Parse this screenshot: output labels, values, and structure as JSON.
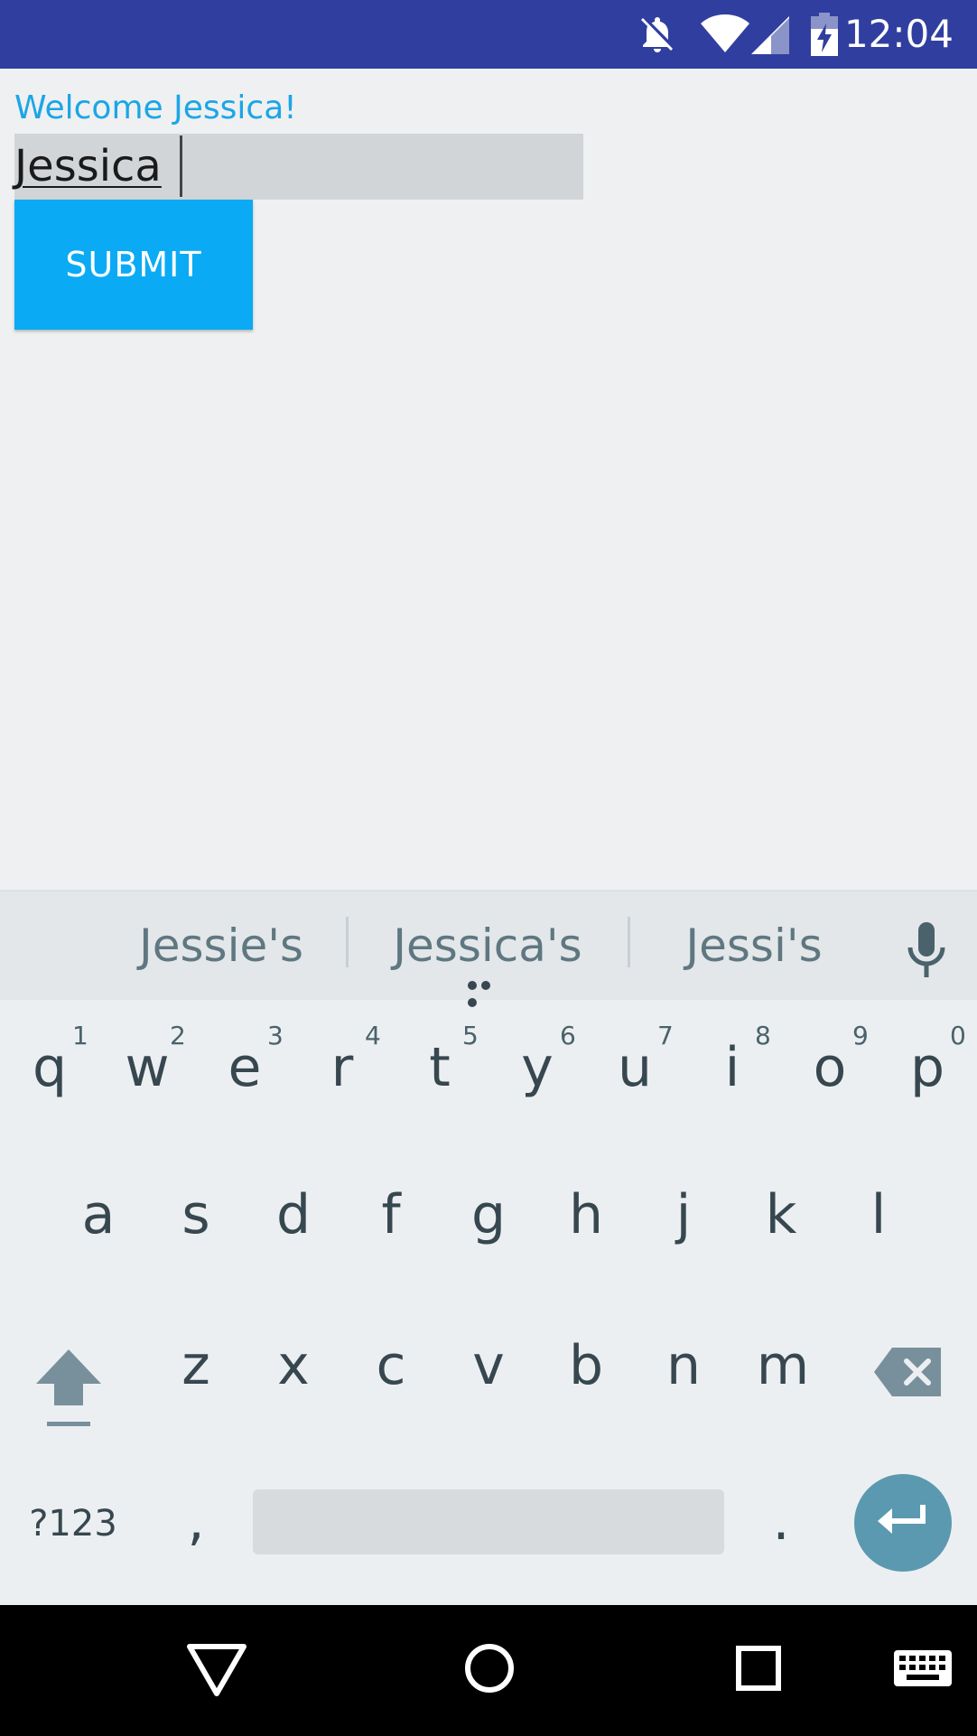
{
  "status_bar": {
    "time": "12:04",
    "icons": [
      "notifications-off-icon",
      "wifi-icon",
      "cell-signal-icon",
      "battery-charging-icon"
    ],
    "background": "#303f9f"
  },
  "app": {
    "welcome_text": "Welcome Jessica!",
    "name_input_value": "Jessica",
    "submit_label": "SUBMIT",
    "accent": "#0aabf4"
  },
  "keyboard": {
    "suggestions": [
      "Jessie's",
      "Jessica's",
      "Jessi's"
    ],
    "row1": [
      {
        "key": "q",
        "hint": "1"
      },
      {
        "key": "w",
        "hint": "2"
      },
      {
        "key": "e",
        "hint": "3"
      },
      {
        "key": "r",
        "hint": "4"
      },
      {
        "key": "t",
        "hint": "5"
      },
      {
        "key": "y",
        "hint": "6"
      },
      {
        "key": "u",
        "hint": "7"
      },
      {
        "key": "i",
        "hint": "8"
      },
      {
        "key": "o",
        "hint": "9"
      },
      {
        "key": "p",
        "hint": "0"
      }
    ],
    "row2": [
      "a",
      "s",
      "d",
      "f",
      "g",
      "h",
      "j",
      "k",
      "l"
    ],
    "row3": [
      "z",
      "x",
      "c",
      "v",
      "b",
      "n",
      "m"
    ],
    "symbols_key": "?123",
    "comma_key": ",",
    "period_key": "."
  },
  "nav_bar": {
    "icons": [
      "back-triangle-icon",
      "home-circle-icon",
      "recents-square-icon",
      "keyboard-switch-icon"
    ]
  }
}
